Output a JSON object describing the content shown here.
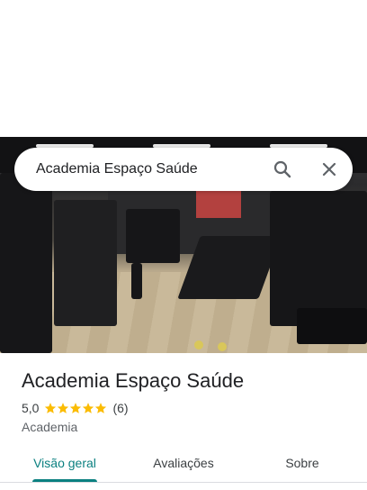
{
  "search": {
    "query": "Academia Espaço Saúde",
    "search_icon": "search-icon",
    "close_icon": "close-icon"
  },
  "photo": {
    "subject": "gym-interior-photo"
  },
  "place": {
    "name": "Academia Espaço Saúde",
    "rating": "5,0",
    "stars": 5,
    "review_count": "(6)",
    "category": "Academia",
    "star_color": "#fbbc04"
  },
  "tabs": [
    {
      "label": "Visão geral",
      "active": true
    },
    {
      "label": "Avaliações",
      "active": false
    },
    {
      "label": "Sobre",
      "active": false
    }
  ],
  "colors": {
    "accent": "#0b8080",
    "text": "#202124",
    "secondary": "#5f6368"
  }
}
